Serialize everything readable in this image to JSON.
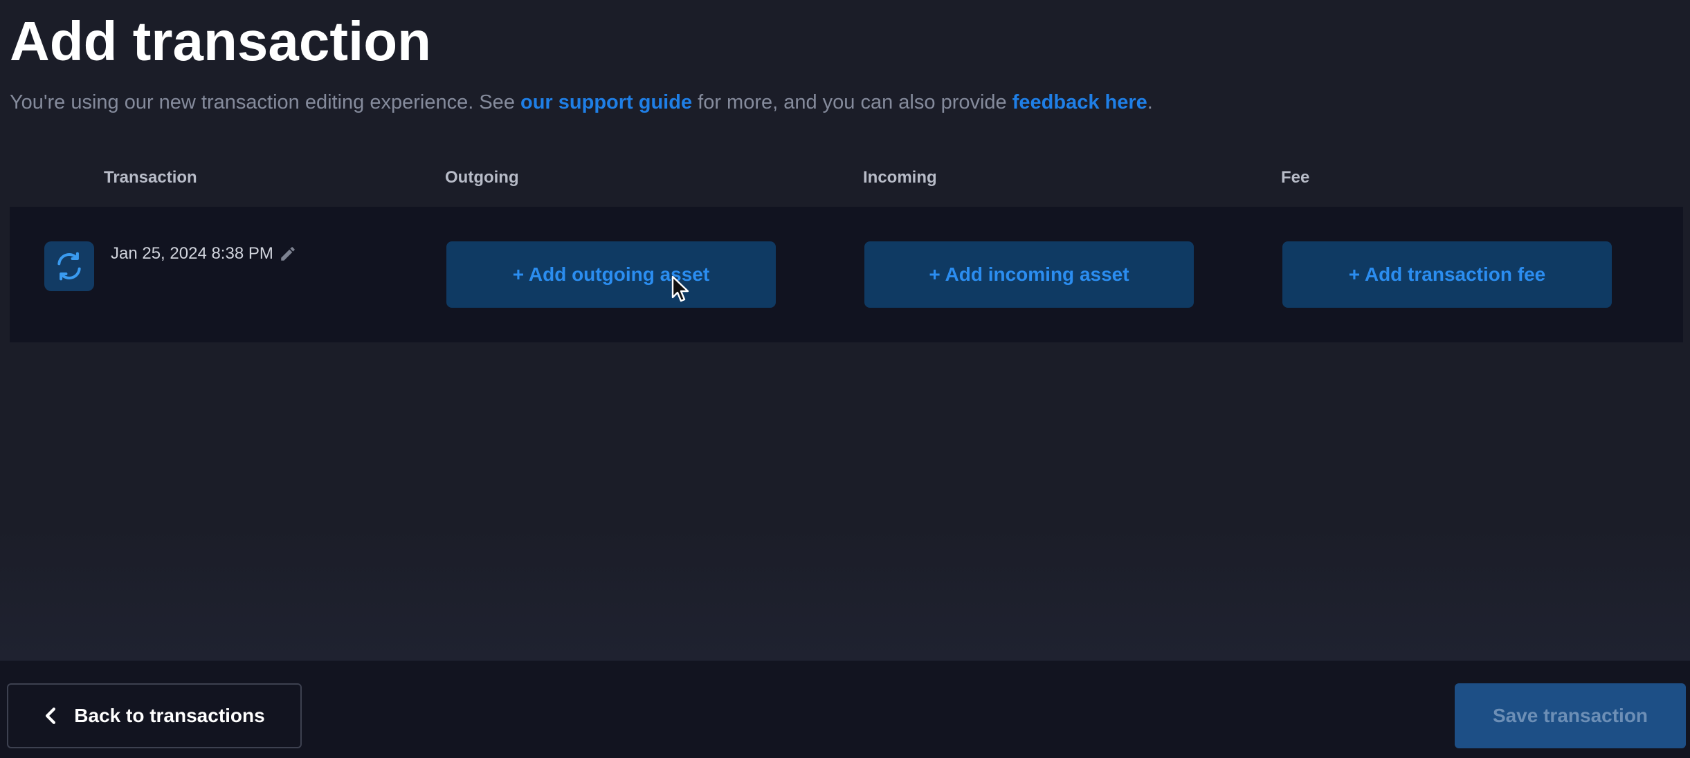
{
  "page": {
    "title": "Add transaction",
    "subtitle_part1": "You're using our new transaction editing experience. See ",
    "support_link": "our support guide",
    "subtitle_part2": " for more, and you can also provide ",
    "feedback_link": "feedback here",
    "subtitle_part3": "."
  },
  "table": {
    "headers": [
      "Transaction",
      "Outgoing",
      "Incoming",
      "Fee"
    ],
    "row": {
      "icon": "swap-icon",
      "date": "Jan 25, 2024 8:38 PM",
      "outgoing_button": "+ Add outgoing asset",
      "incoming_button": "+ Add incoming asset",
      "fee_button": "+ Add transaction fee"
    }
  },
  "footer": {
    "back_label": "Back to transactions",
    "save_label": "Save transaction"
  },
  "colors": {
    "background": "#1b1d28",
    "accent": "#1f7fe6",
    "button_bg": "#0f3a63",
    "save_bg": "#1d4f86"
  }
}
